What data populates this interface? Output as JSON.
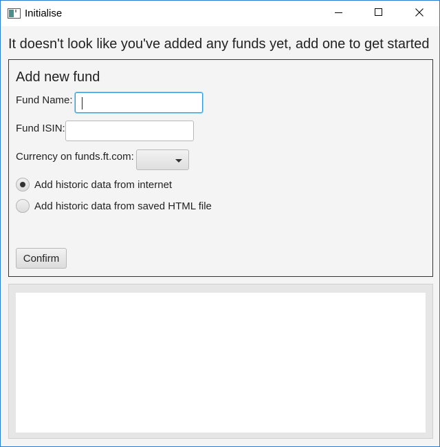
{
  "window": {
    "title": "Initialise",
    "icons": {
      "app": "app-window-icon",
      "minimize": "minimize-icon",
      "maximize": "maximize-icon",
      "close": "close-icon"
    },
    "accent_color": "#2b7bd0"
  },
  "headline": "It doesn't look like you've added any funds yet, add one to get started",
  "form": {
    "title": "Add new fund",
    "fund_name": {
      "label": "Fund Name:",
      "value": "",
      "placeholder": ""
    },
    "fund_isin": {
      "label": "Fund ISIN:",
      "value": "",
      "placeholder": ""
    },
    "currency": {
      "label": "Currency on funds.ft.com:",
      "selected": ""
    },
    "source_options": [
      {
        "label": "Add historic data from internet",
        "selected": true
      },
      {
        "label": "Add historic data from saved HTML file",
        "selected": false
      }
    ],
    "confirm_label": "Confirm"
  },
  "focus_color": "#2b9be0"
}
